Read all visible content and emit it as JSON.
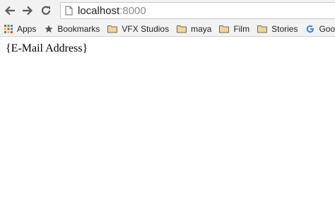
{
  "browser": {
    "url": {
      "host": "localhost",
      "port": ":8000"
    },
    "nav": {
      "back_icon": "arrow-left-icon",
      "forward_icon": "arrow-right-icon",
      "reload_icon": "reload-icon"
    }
  },
  "bookmarks_bar": {
    "items": [
      {
        "label": "Apps",
        "icon": "apps-grid-icon"
      },
      {
        "label": "Bookmarks",
        "icon": "star-icon"
      },
      {
        "label": "VFX Studios",
        "icon": "folder-icon"
      },
      {
        "label": "maya",
        "icon": "folder-icon"
      },
      {
        "label": "Film",
        "icon": "folder-icon"
      },
      {
        "label": "Stories",
        "icon": "folder-icon"
      },
      {
        "label": "Google",
        "icon": "google-icon"
      }
    ],
    "overflow_icon": "chevron-more-icon"
  },
  "page": {
    "body_text": "{E-Mail Address}"
  }
}
